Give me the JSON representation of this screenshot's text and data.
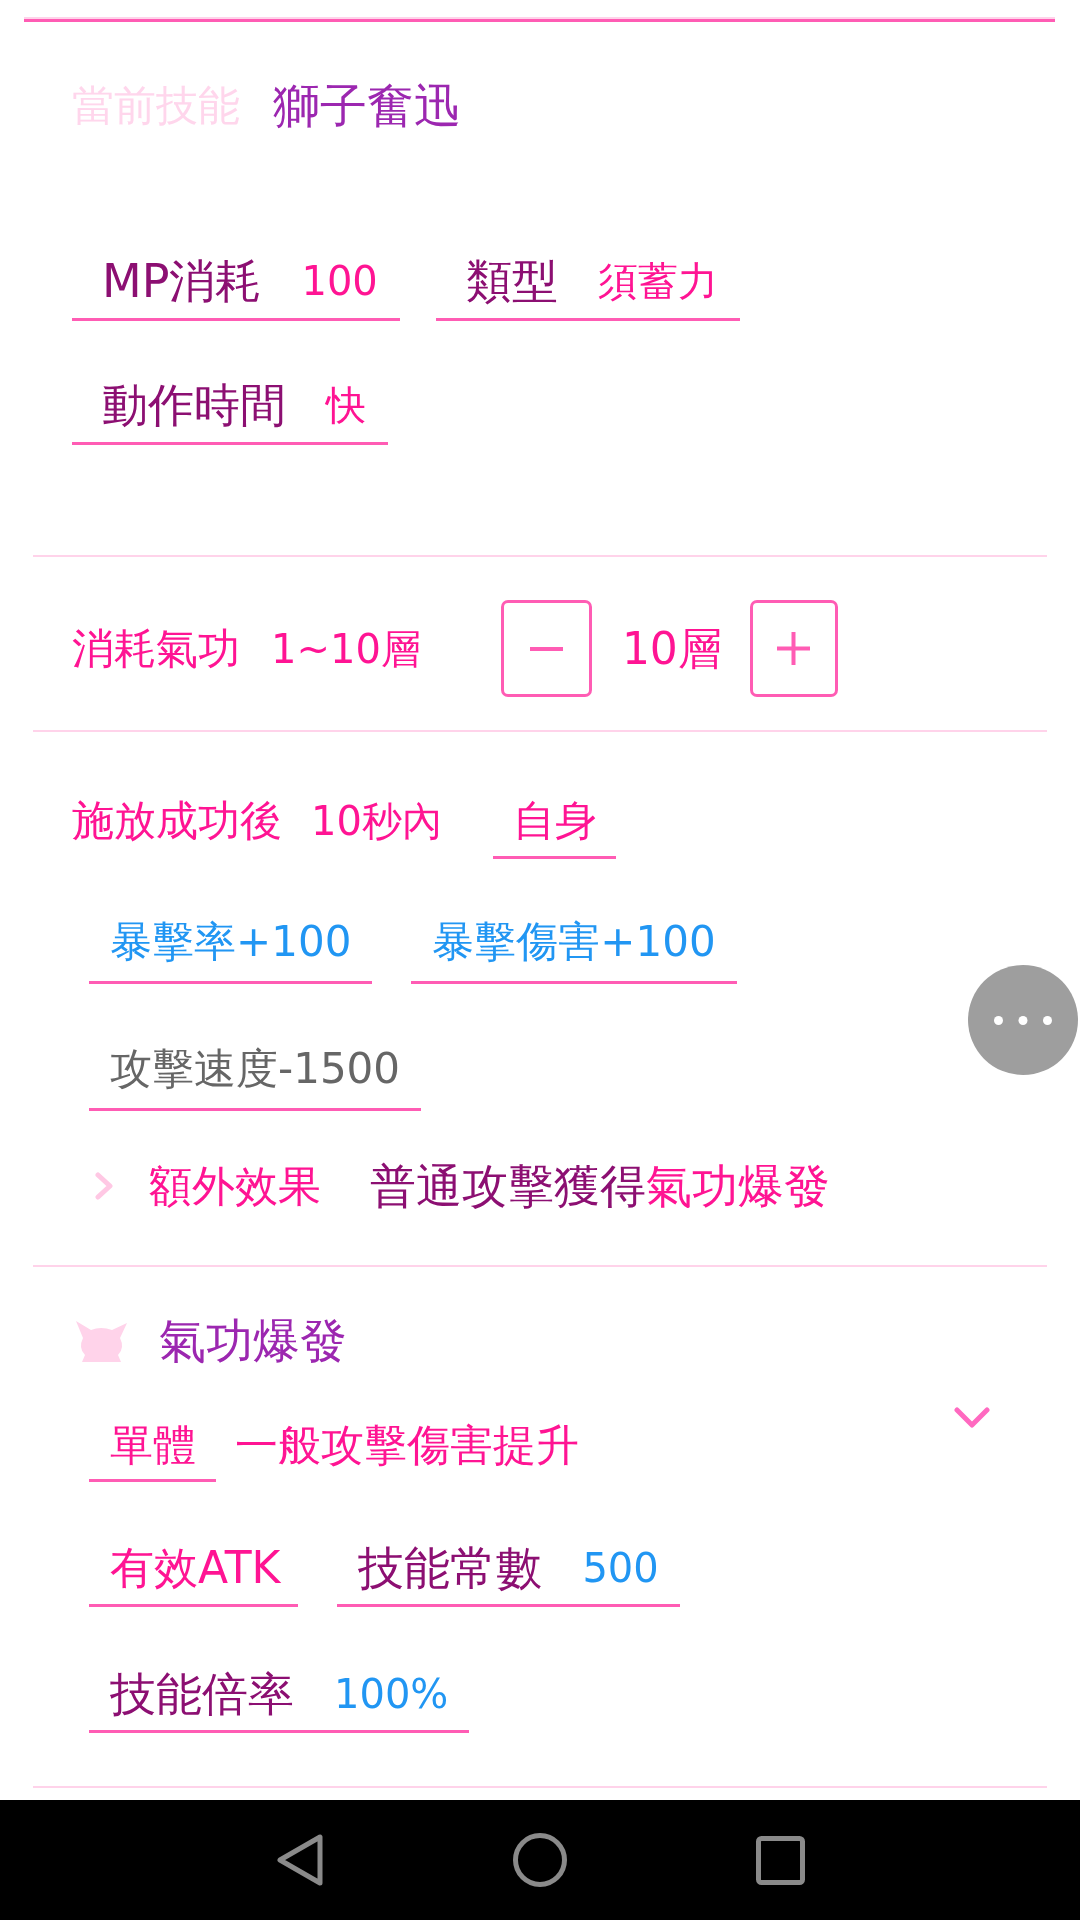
{
  "header": {
    "label": "當前技能",
    "skill_name": "獅子奮迅"
  },
  "skill_info": [
    {
      "label": "MP消耗",
      "value": "100"
    },
    {
      "label": "類型",
      "value": "須蓄力"
    },
    {
      "label": "動作時間",
      "value": "快"
    }
  ],
  "qigong_cost": {
    "label": "消耗氣功",
    "range": "1~10層",
    "amount": "10層"
  },
  "after_cast": {
    "label": "施放成功後",
    "duration": "10秒內",
    "target": "自身",
    "buffs": [
      {
        "text": "暴擊率+100",
        "kind": "bonus"
      },
      {
        "text": "暴擊傷害+100",
        "kind": "bonus"
      },
      {
        "text": "攻擊速度-1500",
        "kind": "penalty"
      }
    ],
    "extra_effect": {
      "label": "額外效果",
      "text": "普通攻擊獲得",
      "highlight": "氣功爆發"
    }
  },
  "effect": {
    "name": "氣功爆發",
    "target": "單體",
    "description": "一般攻擊傷害提升",
    "params": [
      {
        "kind": "term",
        "label": "有效ATK"
      },
      {
        "kind": "stat",
        "label": "技能常數",
        "value": "500"
      },
      {
        "kind": "stat",
        "label": "技能倍率",
        "value": "100%"
      }
    ]
  }
}
